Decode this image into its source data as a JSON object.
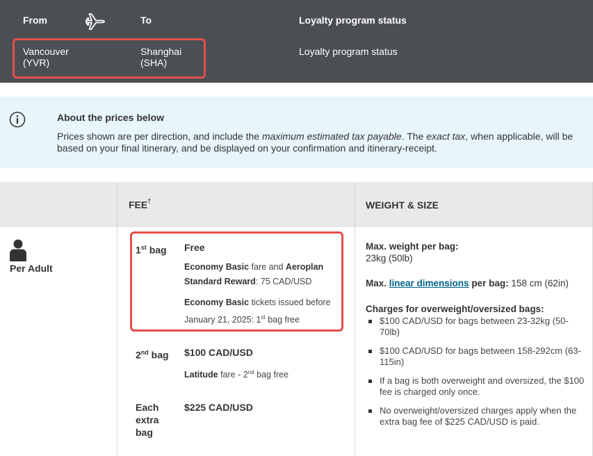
{
  "header": {
    "from_label": "From",
    "to_label": "To",
    "loyalty_label": "Loyalty program status",
    "from_city": "Vancouver",
    "from_code": "(YVR)",
    "to_city": "Shanghai",
    "to_code": "(SHA)",
    "loyalty_value": "Loyalty program status",
    "icon": "plane-icon"
  },
  "info": {
    "icon": "info-icon",
    "title": "About the prices below",
    "text_1": "Prices shown are per direction, and include the ",
    "text_em1": "maximum estimated tax payable",
    "text_2": ". The ",
    "text_em2": "exact tax",
    "text_3": ", when applicable, will be based on your final itinerary, and be displayed on your confirmation and itinerary-receipt."
  },
  "table": {
    "col_fee": "FEE",
    "col_fee_mark": "†",
    "col_weight": "WEIGHT & SIZE",
    "row_label": "Per Adult",
    "row_icon": "person-icon",
    "bags": [
      {
        "label_num": "1",
        "label_sup": "st",
        "label_word": " bag",
        "price": "Free"
      },
      {
        "label_num": "2",
        "label_sup": "nd",
        "label_word": " bag",
        "price": "$100 CAD/USD"
      },
      {
        "label": "Each extra bag",
        "price": "$225 CAD/USD"
      }
    ],
    "notes": {
      "n1_b1": "Economy Basic",
      "n1_t1": " fare and ",
      "n1_b2": "Aeroplan Standard Reward",
      "n1_t2": ": 75 CAD/USD",
      "n2_b1": "Economy Basic",
      "n2_t1": " tickets issued before January 21, 2025: 1",
      "n2_sup": "st",
      "n2_t2": " bag free",
      "n3_b1": "Latitude",
      "n3_t1": " fare - 2",
      "n3_sup": "nd",
      "n3_t2": " bag free"
    },
    "weight": {
      "max_weight_title": "Max. weight per bag:",
      "max_weight_value": "23kg (50lb)",
      "dim_title_pre": "Max. ",
      "dim_link": "linear dimensions",
      "dim_title_post": " per bag:",
      "dim_value": " 158 cm (62in)",
      "charges_title": "Charges for overweight/oversized bags:",
      "charges": [
        "$100 CAD/USD for bags between 23-32kg (50-70lb)",
        "$100 CAD/USD for bags between 158-292cm (63-115in)",
        "If a bag is both overweight and oversized, the $100 fee is charged only once.",
        "No overweight/oversized charges apply when the extra bag fee of $225 CAD/USD is paid."
      ]
    }
  },
  "colors": {
    "header_bg": "#4b4e52",
    "highlight": "#e2504c",
    "info_bg": "#e8f5fb",
    "link": "#00638a"
  }
}
